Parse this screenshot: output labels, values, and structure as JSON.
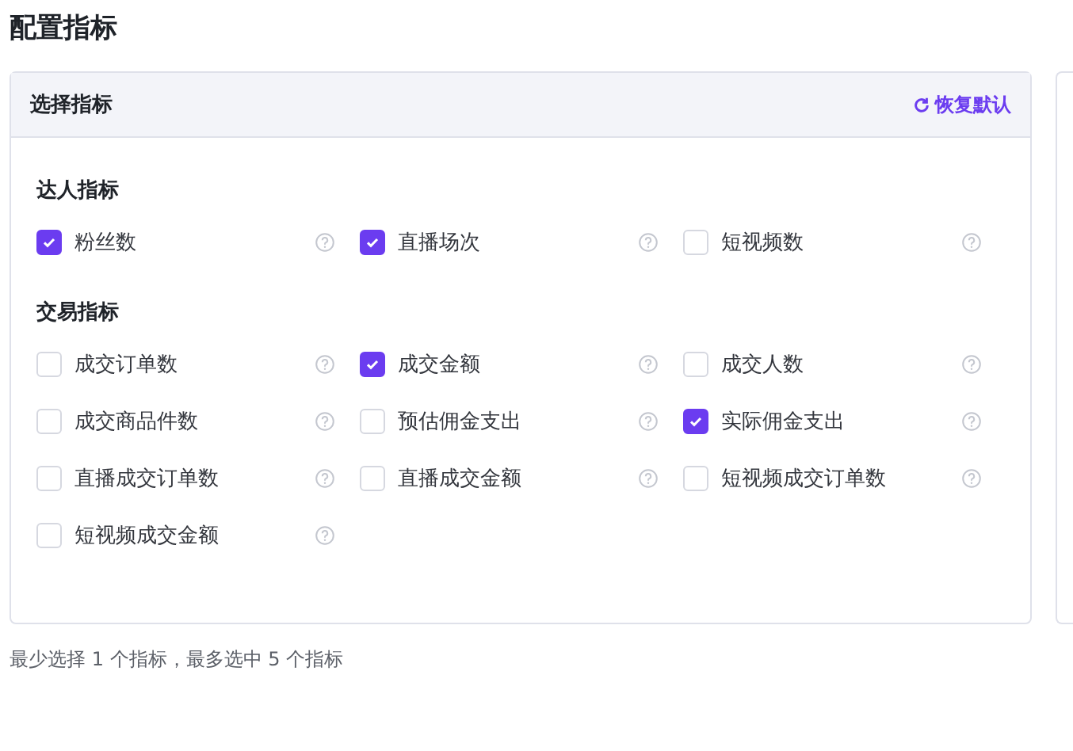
{
  "title": "配置指标",
  "card": {
    "title": "选择指标",
    "reset_link": "恢复默认",
    "groups": [
      {
        "title": "达人指标",
        "items": [
          {
            "label": "粉丝数",
            "checked": true
          },
          {
            "label": "直播场次",
            "checked": true
          },
          {
            "label": "短视频数",
            "checked": false
          }
        ]
      },
      {
        "title": "交易指标",
        "items": [
          {
            "label": "成交订单数",
            "checked": false
          },
          {
            "label": "成交金额",
            "checked": true
          },
          {
            "label": "成交人数",
            "checked": false
          },
          {
            "label": "成交商品件数",
            "checked": false
          },
          {
            "label": "预估佣金支出",
            "checked": false
          },
          {
            "label": "实际佣金支出",
            "checked": true
          },
          {
            "label": "直播成交订单数",
            "checked": false
          },
          {
            "label": "直播成交金额",
            "checked": false
          },
          {
            "label": "短视频成交订单数",
            "checked": false
          },
          {
            "label": "短视频成交金额",
            "checked": false
          }
        ]
      }
    ]
  },
  "footer": "最少选择 1 个指标，最多选中 5 个指标"
}
